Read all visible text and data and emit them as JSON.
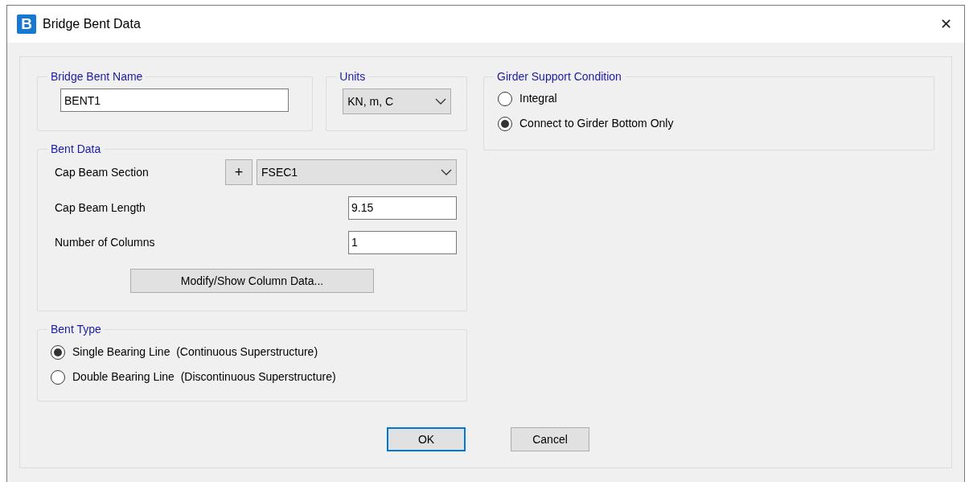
{
  "window": {
    "icon_letter": "B",
    "title": "Bridge Bent Data",
    "close": "✕"
  },
  "name_group": {
    "title": "Bridge Bent Name",
    "value": "BENT1"
  },
  "units_group": {
    "title": "Units",
    "value": "KN, m, C"
  },
  "bent_data": {
    "title": "Bent Data",
    "section_label": "Cap Beam Section",
    "add": "+",
    "section_value": "FSEC1",
    "length_label": "Cap Beam Length",
    "length_value": "9.15",
    "columns_label": "Number of Columns",
    "columns_value": "1",
    "column_button": "Modify/Show Column Data..."
  },
  "bent_type": {
    "title": "Bent Type",
    "options": [
      {
        "label": "Single Bearing Line  (Continuous Superstructure)",
        "selected": true
      },
      {
        "label": "Double Bearing Line  (Discontinuous Superstructure)",
        "selected": false
      }
    ]
  },
  "girder_support": {
    "title": "Girder Support Condition",
    "options": [
      {
        "label": "Integral",
        "selected": false
      },
      {
        "label": "Connect to Girder Bottom Only",
        "selected": true
      }
    ]
  },
  "buttons": [
    {
      "label": "OK",
      "default": true
    },
    {
      "label": "Cancel",
      "default": false
    }
  ]
}
